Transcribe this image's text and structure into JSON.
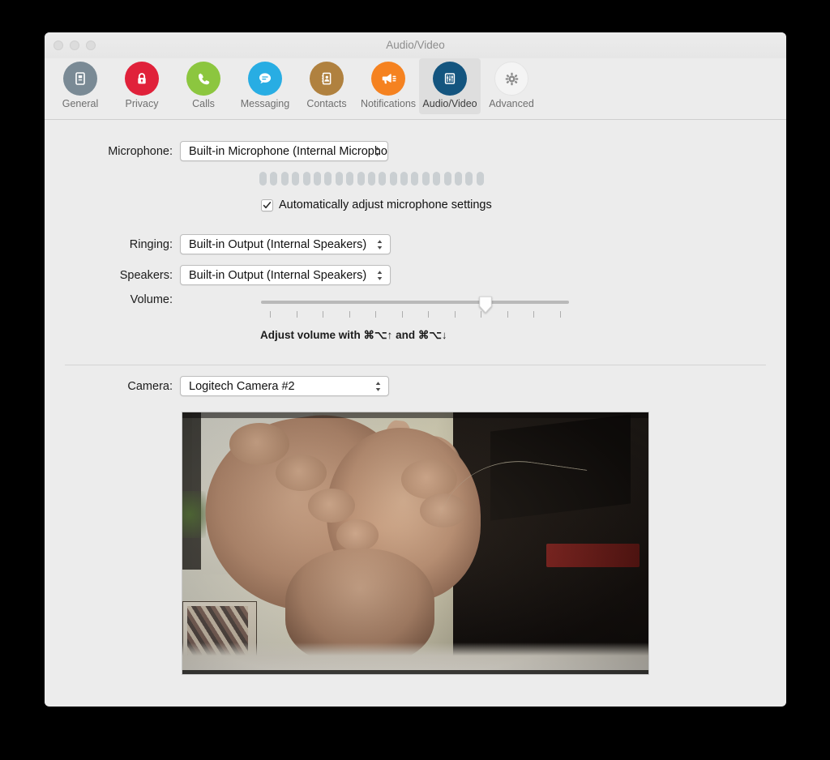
{
  "window": {
    "title": "Audio/Video",
    "traffic_lights": [
      "close",
      "minimize",
      "zoom"
    ]
  },
  "toolbar": {
    "tabs": [
      {
        "label": "General",
        "icon": "id-card-icon",
        "color": "#7a8a95",
        "selected": false
      },
      {
        "label": "Privacy",
        "icon": "lock-icon",
        "color": "#e0213a",
        "selected": false
      },
      {
        "label": "Calls",
        "icon": "phone-icon",
        "color": "#8cc63f",
        "selected": false
      },
      {
        "label": "Messaging",
        "icon": "chat-bubble-icon",
        "color": "#28ade3",
        "selected": false
      },
      {
        "label": "Contacts",
        "icon": "contacts-icon",
        "color": "#b0813f",
        "selected": false
      },
      {
        "label": "Notifications",
        "icon": "megaphone-icon",
        "color": "#f58220",
        "selected": false
      },
      {
        "label": "Audio/Video",
        "icon": "mixer-sliders-icon",
        "color": "#14557f",
        "selected": true
      },
      {
        "label": "Advanced",
        "icon": "gear-icon",
        "color": "#f2f2f2",
        "selected": false
      }
    ]
  },
  "audio": {
    "microphone_label": "Microphone:",
    "microphone_value": "Built-in Microphone (Internal Microphone)",
    "level_segments": 21,
    "level_active": 0,
    "auto_adjust_label": "Automatically adjust microphone settings",
    "auto_adjust_checked": true,
    "ringing_label": "Ringing:",
    "ringing_value": "Built-in Output (Internal Speakers)",
    "speakers_label": "Speakers:",
    "speakers_value": "Built-in Output (Internal Speakers)",
    "volume_label": "Volume:",
    "volume_percent": 73,
    "volume_ticks": 12,
    "volume_hint": "Adjust volume with ⌘⌥↑ and ⌘⌥↓"
  },
  "camera": {
    "label": "Camera:",
    "value": "Logitech Camera #2",
    "preview_alt": "Live webcam preview"
  }
}
